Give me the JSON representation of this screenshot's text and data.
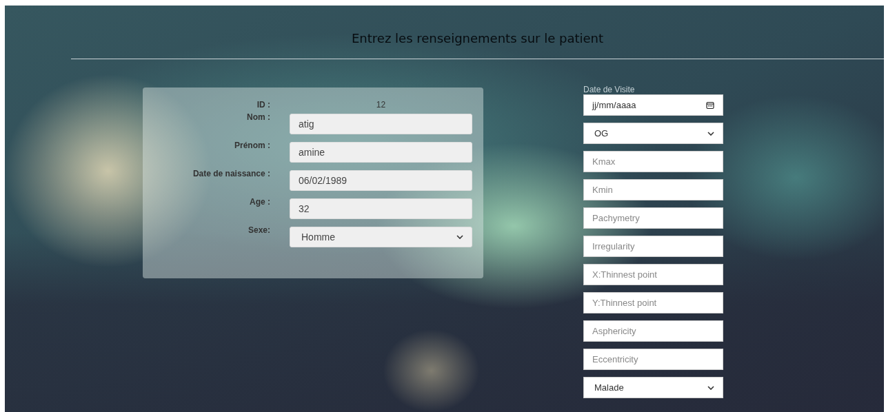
{
  "title": "Entrez les renseignements sur le patient",
  "patient": {
    "id_label": "ID :",
    "id": "12",
    "fields": [
      {
        "kind": "text",
        "label": "Nom :",
        "value": "atig"
      },
      {
        "kind": "text",
        "label": "Prénom :",
        "value": "amine"
      },
      {
        "kind": "text",
        "label": "Date de naissance :",
        "value": "06/02/1989"
      },
      {
        "kind": "text",
        "label": "Age :",
        "value": "32"
      },
      {
        "kind": "select",
        "label": "Sexe:",
        "value": "Homme"
      }
    ]
  },
  "visit": {
    "label": "Date de Visite",
    "fields": [
      {
        "kind": "date",
        "placeholder": "jj/mm/aaaa"
      },
      {
        "kind": "select",
        "value": "OG"
      },
      {
        "kind": "text",
        "placeholder": "Kmax"
      },
      {
        "kind": "text",
        "placeholder": "Kmin"
      },
      {
        "kind": "text",
        "placeholder": "Pachymetry"
      },
      {
        "kind": "text",
        "placeholder": "Irregularity"
      },
      {
        "kind": "text",
        "placeholder": "X:Thinnest point"
      },
      {
        "kind": "text",
        "placeholder": "Y:Thinnest point"
      },
      {
        "kind": "text",
        "placeholder": "Asphericity"
      },
      {
        "kind": "text",
        "placeholder": "Eccentricity"
      },
      {
        "kind": "select",
        "value": "Malade"
      }
    ]
  }
}
